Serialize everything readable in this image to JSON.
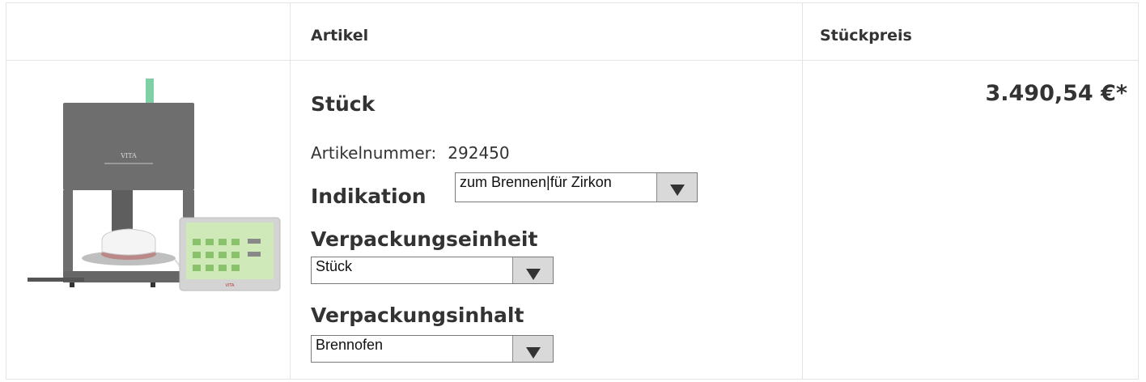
{
  "table": {
    "headers": {
      "image": "",
      "article": "Artikel",
      "unit_price": "Stückpreis"
    }
  },
  "product": {
    "image_alt": "Brennofen mit Bedienteil",
    "logo_text": "VITA",
    "panel_logo_text": "VITA",
    "title": "Stück",
    "article_number_label": "Artikelnummer:",
    "article_number": "292450",
    "price": "3.490,54 €*"
  },
  "options": {
    "indikation": {
      "label": "Indikation",
      "value": "zum Brennen|für Zirkon"
    },
    "verpackungseinheit": {
      "label": "Verpackungseinheit",
      "value": "Stück"
    },
    "verpackungsinhalt": {
      "label": "Verpackungsinhalt",
      "value": "Brennofen"
    }
  },
  "colors": {
    "border": "#e4e4e4",
    "furnace": "#707070",
    "screen": "#cfe9b8"
  },
  "icons": {
    "select_arrow": "caret-down-icon"
  }
}
